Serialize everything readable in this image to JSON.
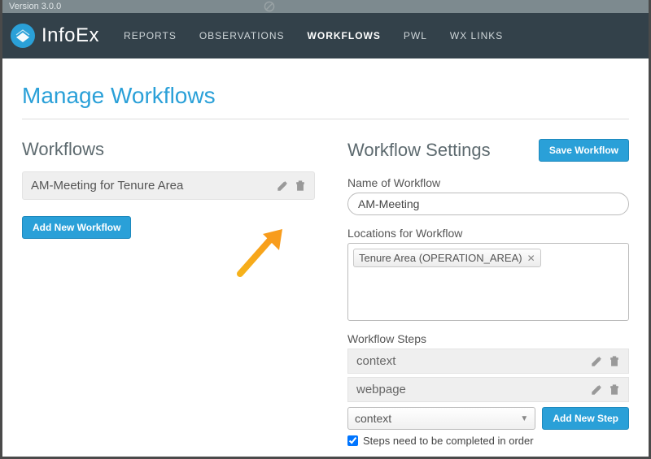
{
  "version": "Version 3.0.0",
  "brand": "InfoEx",
  "nav": [
    "REPORTS",
    "OBSERVATIONS",
    "WORKFLOWS",
    "PWL",
    "WX LINKS"
  ],
  "nav_active": 2,
  "page_title": "Manage Workflows",
  "left": {
    "heading": "Workflows",
    "rows": [
      "AM-Meeting for Tenure Area"
    ],
    "add_btn": "Add New Workflow"
  },
  "right": {
    "heading": "Workflow Settings",
    "save_btn": "Save Workflow",
    "name_label": "Name of Workflow",
    "name_value": "AM-Meeting",
    "loc_label": "Locations for Workflow",
    "loc_chips": [
      "Tenure Area (OPERATION_AREA)"
    ],
    "steps_label": "Workflow Steps",
    "steps": [
      "context",
      "webpage"
    ],
    "select_value": "context",
    "add_step_btn": "Add New Step",
    "order_checkbox_label": "Steps need to be completed in order",
    "order_checked": true
  }
}
